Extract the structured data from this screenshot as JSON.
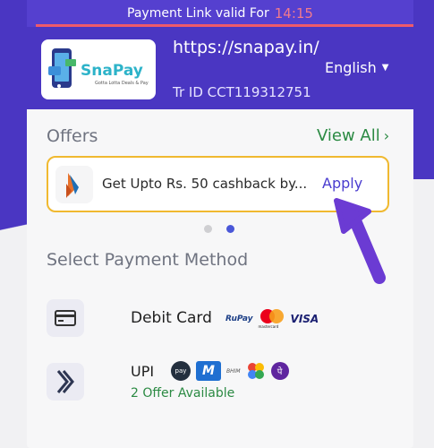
{
  "banner": {
    "label": "Payment Link valid For",
    "time": "14:15"
  },
  "header": {
    "logo_text": "SnaPay",
    "logo_tagline": "Gotta Lotta Deals & Pay",
    "url": "https://snapay.in/",
    "transaction_id": "Tr ID CCT119312751",
    "language": "English"
  },
  "offers": {
    "title": "Offers",
    "view_all": "View All",
    "items": [
      {
        "text": "Get Upto Rs. 50 cashback by...",
        "action": "Apply"
      }
    ],
    "carousel_pages": 2,
    "active_page": 2
  },
  "payment": {
    "title": "Select Payment Method",
    "methods": [
      {
        "label": "Debit Card",
        "icon": "card-icon",
        "brands": [
          "RuPay",
          "mastercard",
          "VISA"
        ]
      },
      {
        "label": "UPI",
        "icon": "upi-icon",
        "offer_note": "2 Offer Available",
        "apps": [
          "pay",
          "M",
          "BHIM",
          "google-pay",
          "phonepe"
        ]
      }
    ]
  },
  "colors": {
    "brand": "#4a36c2",
    "accent_green": "#2b8a43",
    "offer_border": "#f0b930",
    "timer": "#f27a8c",
    "pointer_arrow": "#6b3bd3"
  }
}
